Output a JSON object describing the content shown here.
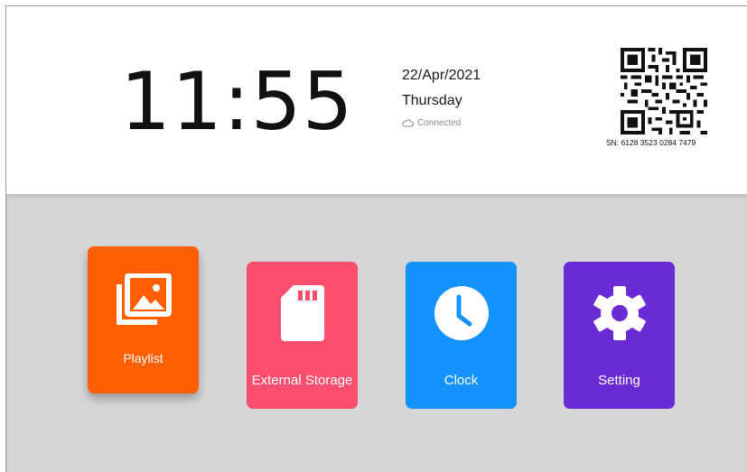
{
  "header": {
    "time": "11:55",
    "date": "22/Apr/2021",
    "weekday": "Thursday",
    "connection_status": "Connected",
    "serial_number": "SN: 6128 3523 0284 7479"
  },
  "tiles": [
    {
      "label": "Playlist",
      "icon": "gallery-icon",
      "color": "#ff5f00"
    },
    {
      "label": "External Storage",
      "icon": "sd-card-icon",
      "color": "#fc4e6e"
    },
    {
      "label": "Clock",
      "icon": "clock-icon",
      "color": "#1492ff"
    },
    {
      "label": "Setting",
      "icon": "gear-icon",
      "color": "#6a2ad6"
    }
  ],
  "colors": {
    "top_background": "#ffffff",
    "bottom_background": "#d6d6d6"
  }
}
